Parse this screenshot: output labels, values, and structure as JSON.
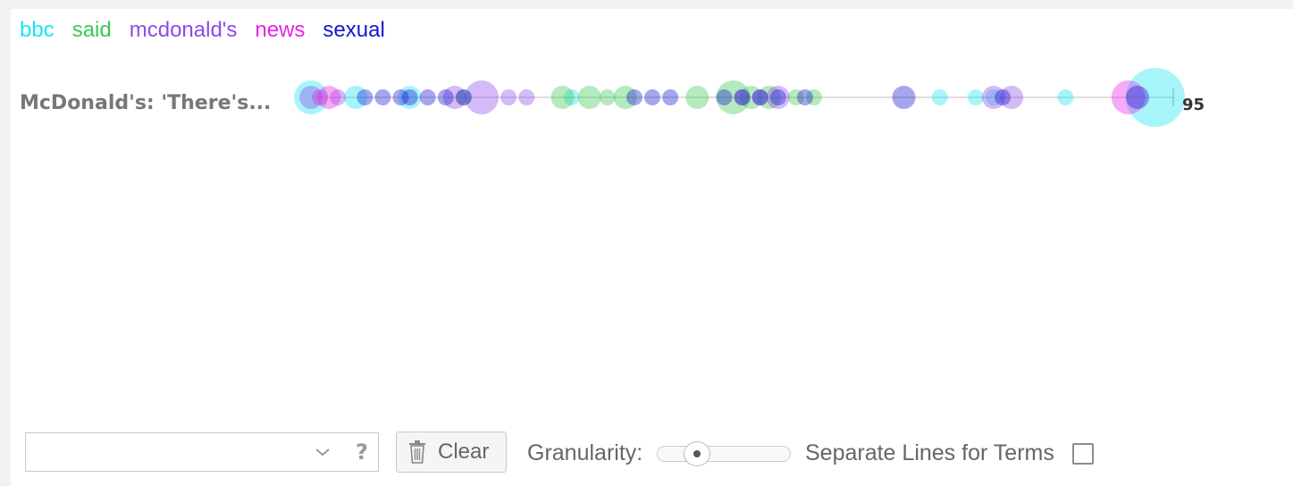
{
  "legend": {
    "terms": [
      {
        "label": "bbc",
        "color": "#17e6f0"
      },
      {
        "label": "said",
        "color": "#3cc74f"
      },
      {
        "label": "mcdonald's",
        "color": "#8f4ae8"
      },
      {
        "label": "news",
        "color": "#e623e6"
      },
      {
        "label": "sexual",
        "color": "#1515d6"
      }
    ]
  },
  "document": {
    "title": "McDonald's: 'There's...",
    "end_value": "95"
  },
  "chart_data": {
    "type": "scatter",
    "x_range": [
      1,
      95
    ],
    "series": [
      {
        "name": "bbc",
        "color": "#17e6f0",
        "points": [
          {
            "x": 1,
            "r": 3
          },
          {
            "x": 6,
            "r": 2
          },
          {
            "x": 12,
            "r": 2
          },
          {
            "x": 30,
            "r": 1
          },
          {
            "x": 71,
            "r": 1
          },
          {
            "x": 75,
            "r": 1
          },
          {
            "x": 77,
            "r": 1
          },
          {
            "x": 85,
            "r": 1
          },
          {
            "x": 95,
            "r": 4
          }
        ]
      },
      {
        "name": "said",
        "color": "#3cc74f",
        "points": [
          {
            "x": 18,
            "r": 1
          },
          {
            "x": 29,
            "r": 2
          },
          {
            "x": 32,
            "r": 2
          },
          {
            "x": 34,
            "r": 1
          },
          {
            "x": 36,
            "r": 2
          },
          {
            "x": 44,
            "r": 2
          },
          {
            "x": 48,
            "r": 3
          },
          {
            "x": 50,
            "r": 2
          },
          {
            "x": 52,
            "r": 2
          },
          {
            "x": 55,
            "r": 1
          },
          {
            "x": 57,
            "r": 1
          }
        ]
      },
      {
        "name": "mcdonald's",
        "color": "#8f4ae8",
        "points": [
          {
            "x": 1,
            "r": 2
          },
          {
            "x": 4,
            "r": 1
          },
          {
            "x": 17,
            "r": 2
          },
          {
            "x": 20,
            "r": 3
          },
          {
            "x": 23,
            "r": 1
          },
          {
            "x": 25,
            "r": 1
          },
          {
            "x": 49,
            "r": 1
          },
          {
            "x": 51,
            "r": 1
          },
          {
            "x": 53,
            "r": 2
          },
          {
            "x": 77,
            "r": 2
          },
          {
            "x": 79,
            "r": 2
          }
        ]
      },
      {
        "name": "news",
        "color": "#e623e6",
        "points": [
          {
            "x": 2,
            "r": 1
          },
          {
            "x": 3,
            "r": 2
          },
          {
            "x": 92,
            "r": 3
          }
        ]
      },
      {
        "name": "sexual",
        "color": "#1515d6",
        "points": [
          {
            "x": 7,
            "r": 1
          },
          {
            "x": 9,
            "r": 1
          },
          {
            "x": 11,
            "r": 1
          },
          {
            "x": 12,
            "r": 1
          },
          {
            "x": 14,
            "r": 1
          },
          {
            "x": 16,
            "r": 1
          },
          {
            "x": 18,
            "r": 1
          },
          {
            "x": 37,
            "r": 1
          },
          {
            "x": 39,
            "r": 1
          },
          {
            "x": 41,
            "r": 1
          },
          {
            "x": 47,
            "r": 1
          },
          {
            "x": 49,
            "r": 1
          },
          {
            "x": 51,
            "r": 1
          },
          {
            "x": 53,
            "r": 1
          },
          {
            "x": 56,
            "r": 1
          },
          {
            "x": 67,
            "r": 2
          },
          {
            "x": 78,
            "r": 1
          },
          {
            "x": 93,
            "r": 2
          }
        ]
      }
    ]
  },
  "toolbar": {
    "search_placeholder": "",
    "help_label": "?",
    "clear_label": "Clear",
    "granularity_label": "Granularity:",
    "granularity_level": 0.2,
    "separate_lines_label": "Separate Lines for Terms",
    "separate_lines_checked": false
  },
  "icons": {
    "dropdown": "chevron-down-icon",
    "clear": "trash-icon",
    "help": "help-icon"
  }
}
